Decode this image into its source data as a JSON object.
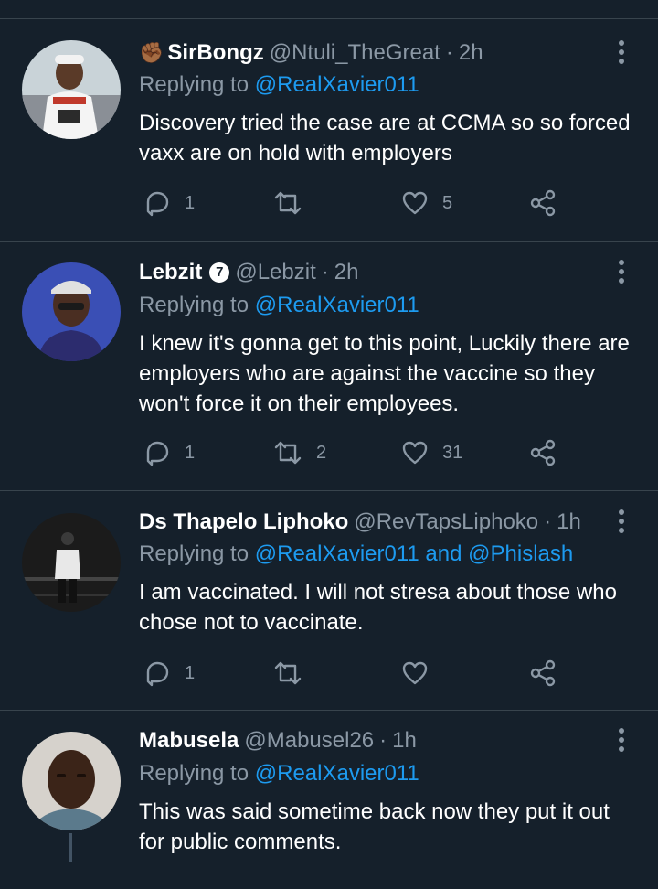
{
  "replies": [
    {
      "emoji": "✊🏾",
      "name": "SirBongz",
      "handle": "@Ntuli_TheGreat",
      "dot": "·",
      "time": "2h",
      "replying_prefix": "Replying to",
      "replying_to": "@RealXavier011",
      "text": "Discovery tried the case are at CCMA so so forced vaxx are on hold with employers",
      "reply_count": "1",
      "retweet_count": "",
      "like_count": "5"
    },
    {
      "name": "Lebzit",
      "verified_symbol": "7",
      "handle": "@Lebzit",
      "dot": "·",
      "time": "2h",
      "replying_prefix": "Replying to",
      "replying_to": "@RealXavier011",
      "text": "I knew it's gonna get to this point, Luckily there are employers who are against the vaccine so they won't force it on their employees.",
      "reply_count": "1",
      "retweet_count": "2",
      "like_count": "31"
    },
    {
      "name": "Ds Thapelo Liphoko",
      "handle": "@RevTapsLiphoko",
      "dot": "·",
      "time": "1h",
      "replying_prefix": "Replying to",
      "replying_to": "@RealXavier011 and @Phislash",
      "text": "I am vaccinated. I will not stresa about those who chose not to vaccinate.",
      "reply_count": "1",
      "retweet_count": "",
      "like_count": ""
    },
    {
      "name": "Mabusela",
      "handle": "@Mabusel26",
      "dot": "·",
      "time": "1h",
      "replying_prefix": "Replying to",
      "replying_to": "@RealXavier011",
      "text": "This was said sometime back now they put it out for public comments."
    }
  ],
  "colors": {
    "background": "#15202b",
    "divider": "#38444d",
    "secondary_text": "#8b98a5",
    "accent": "#1d9bf0"
  },
  "icons": [
    "reply-icon",
    "retweet-icon",
    "like-icon",
    "share-icon",
    "more-options-icon"
  ]
}
